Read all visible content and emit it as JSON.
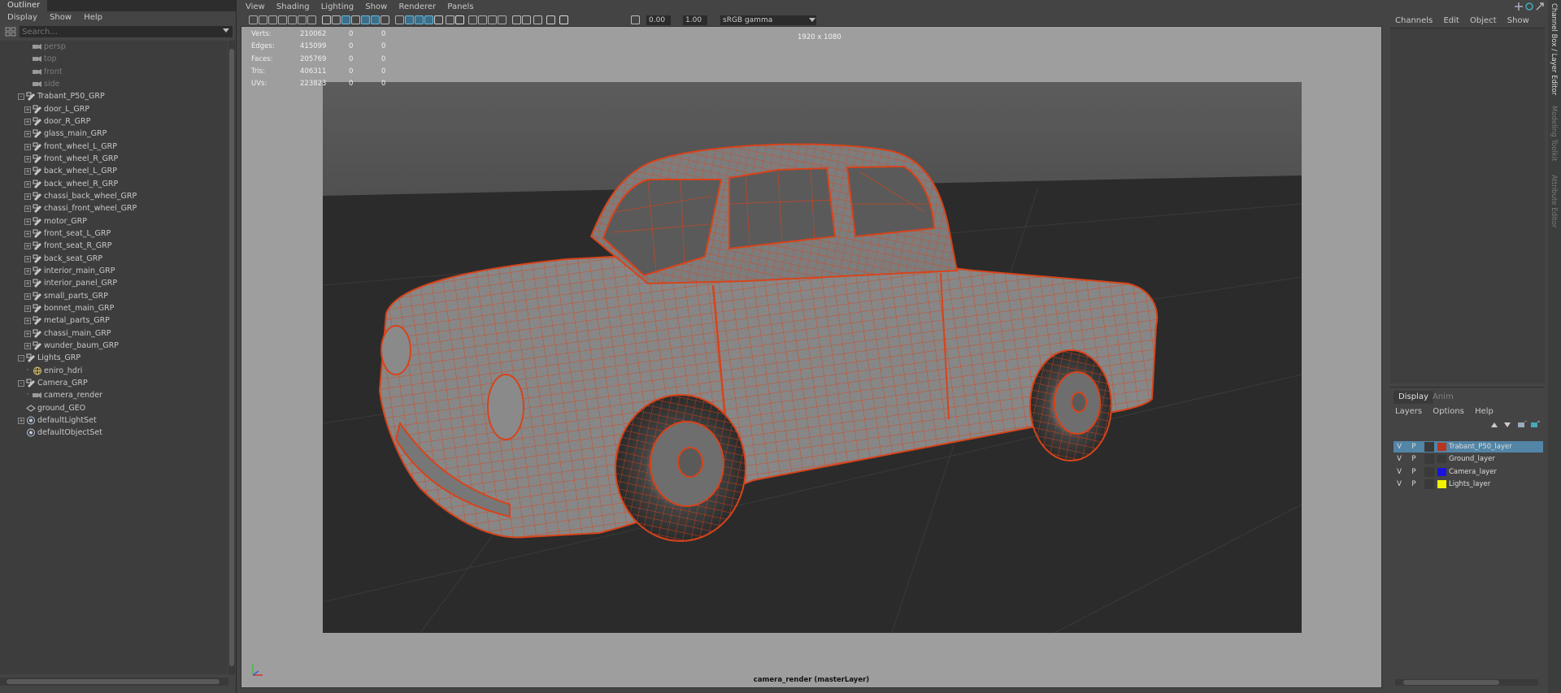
{
  "outliner": {
    "title": "Outliner",
    "menu": [
      "Display",
      "Show",
      "Help"
    ],
    "search_placeholder": "Search...",
    "items": [
      {
        "label": "persp",
        "depth": 1,
        "icon": "camera-icon",
        "dim": true,
        "expander": ""
      },
      {
        "label": "top",
        "depth": 1,
        "icon": "camera-icon",
        "dim": true,
        "expander": ""
      },
      {
        "label": "front",
        "depth": 1,
        "icon": "camera-icon",
        "dim": true,
        "expander": ""
      },
      {
        "label": "side",
        "depth": 1,
        "icon": "camera-icon",
        "dim": true,
        "expander": ""
      },
      {
        "label": "Trabant_P50_GRP",
        "depth": 0,
        "icon": "group-icon",
        "dim": false,
        "expander": "-"
      },
      {
        "label": "door_L_GRP",
        "depth": 1,
        "icon": "group-icon",
        "dim": false,
        "expander": "+"
      },
      {
        "label": "door_R_GRP",
        "depth": 1,
        "icon": "group-icon",
        "dim": false,
        "expander": "+"
      },
      {
        "label": "glass_main_GRP",
        "depth": 1,
        "icon": "group-icon",
        "dim": false,
        "expander": "+"
      },
      {
        "label": "front_wheel_L_GRP",
        "depth": 1,
        "icon": "group-icon",
        "dim": false,
        "expander": "+"
      },
      {
        "label": "front_wheel_R_GRP",
        "depth": 1,
        "icon": "group-icon",
        "dim": false,
        "expander": "+"
      },
      {
        "label": "back_wheel_L_GRP",
        "depth": 1,
        "icon": "group-icon",
        "dim": false,
        "expander": "+"
      },
      {
        "label": "back_wheel_R_GRP",
        "depth": 1,
        "icon": "group-icon",
        "dim": false,
        "expander": "+"
      },
      {
        "label": "chassi_back_wheel_GRP",
        "depth": 1,
        "icon": "group-icon",
        "dim": false,
        "expander": "+"
      },
      {
        "label": "chassi_front_wheel_GRP",
        "depth": 1,
        "icon": "group-icon",
        "dim": false,
        "expander": "+"
      },
      {
        "label": "motor_GRP",
        "depth": 1,
        "icon": "group-icon",
        "dim": false,
        "expander": "+"
      },
      {
        "label": "front_seat_L_GRP",
        "depth": 1,
        "icon": "group-icon",
        "dim": false,
        "expander": "+"
      },
      {
        "label": "front_seat_R_GRP",
        "depth": 1,
        "icon": "group-icon",
        "dim": false,
        "expander": "+"
      },
      {
        "label": "back_seat_GRP",
        "depth": 1,
        "icon": "group-icon",
        "dim": false,
        "expander": "+"
      },
      {
        "label": "interior_main_GRP",
        "depth": 1,
        "icon": "group-icon",
        "dim": false,
        "expander": "+"
      },
      {
        "label": "interior_panel_GRP",
        "depth": 1,
        "icon": "group-icon",
        "dim": false,
        "expander": "+"
      },
      {
        "label": "small_parts_GRP",
        "depth": 1,
        "icon": "group-icon",
        "dim": false,
        "expander": "+"
      },
      {
        "label": "bonnet_main_GRP",
        "depth": 1,
        "icon": "group-icon",
        "dim": false,
        "expander": "+"
      },
      {
        "label": "metal_parts_GRP",
        "depth": 1,
        "icon": "group-icon",
        "dim": false,
        "expander": "+"
      },
      {
        "label": "chassi_main_GRP",
        "depth": 1,
        "icon": "group-icon",
        "dim": false,
        "expander": "+"
      },
      {
        "label": "wunder_baum_GRP",
        "depth": 1,
        "icon": "group-icon",
        "dim": false,
        "expander": "+"
      },
      {
        "label": "Lights_GRP",
        "depth": 0,
        "icon": "group-icon",
        "dim": false,
        "expander": "-"
      },
      {
        "label": "eniro_hdri",
        "depth": 1,
        "icon": "light-icon",
        "dim": false,
        "expander": "•"
      },
      {
        "label": "Camera_GRP",
        "depth": 0,
        "icon": "group-icon",
        "dim": false,
        "expander": "-"
      },
      {
        "label": "camera_render",
        "depth": 1,
        "icon": "camera-icon",
        "dim": false,
        "expander": "•"
      },
      {
        "label": "ground_GEO",
        "depth": 0,
        "icon": "mesh-icon",
        "dim": false,
        "expander": ""
      },
      {
        "label": "defaultLightSet",
        "depth": 0,
        "icon": "set-icon",
        "dim": false,
        "expander": "+"
      },
      {
        "label": "defaultObjectSet",
        "depth": 0,
        "icon": "set-icon",
        "dim": false,
        "expander": ""
      }
    ]
  },
  "viewport": {
    "menu": [
      "View",
      "Shading",
      "Lighting",
      "Show",
      "Renderer",
      "Panels"
    ],
    "exposure": "0.00",
    "gamma": "1.00",
    "colorspace": "sRGB gamma",
    "resolution_label": "1920 x 1080",
    "camera_label": "camera_render (masterLayer)",
    "hud": [
      {
        "label": "Verts:",
        "v1": "210062",
        "v2": "0",
        "v3": "0"
      },
      {
        "label": "Edges:",
        "v1": "415099",
        "v2": "0",
        "v3": "0"
      },
      {
        "label": "Faces:",
        "v1": "205769",
        "v2": "0",
        "v3": "0"
      },
      {
        "label": "Tris:",
        "v1": "406311",
        "v2": "0",
        "v3": "0"
      },
      {
        "label": "UVs:",
        "v1": "223823",
        "v2": "0",
        "v3": "0"
      }
    ],
    "wire_color": "#d8431a"
  },
  "channelbox": {
    "menu": [
      "Channels",
      "Edit",
      "Object",
      "Show"
    ],
    "layer_tabs": {
      "display": "Display",
      "anim": "Anim"
    },
    "layer_menu": [
      "Layers",
      "Options",
      "Help"
    ],
    "layers": [
      {
        "v": "V",
        "p": "P",
        "name": "Trabant_P50_layer",
        "color": "#b8351f",
        "selected": true
      },
      {
        "v": "V",
        "p": "P",
        "name": "Ground_layer",
        "color": "#3a3a3a",
        "selected": false
      },
      {
        "v": "V",
        "p": "P",
        "name": "Camera_layer",
        "color": "#1a14d8",
        "selected": false
      },
      {
        "v": "V",
        "p": "P",
        "name": "Lights_layer",
        "color": "#f2f200",
        "selected": false
      }
    ],
    "side_tabs": [
      "Channel Box / Layer Editor",
      "Modeling Toolkit",
      "Attribute Editor"
    ]
  }
}
